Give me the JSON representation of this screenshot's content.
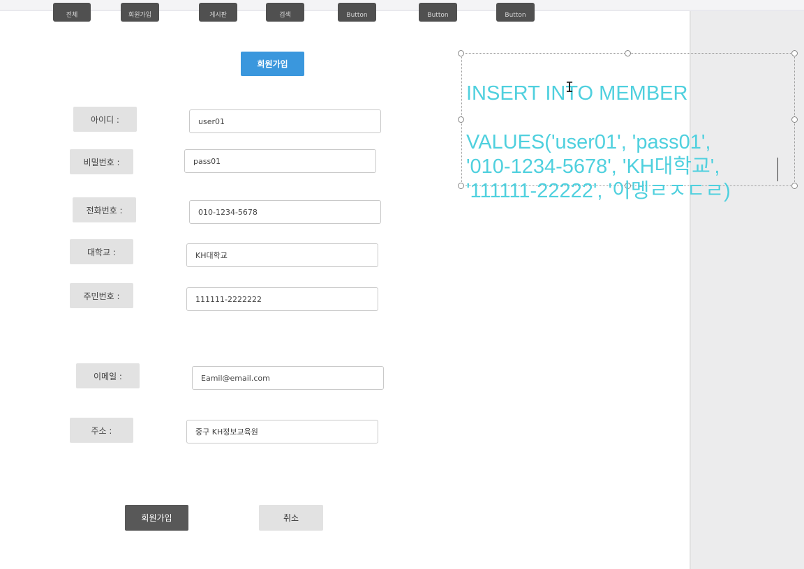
{
  "top_buttons": [
    "전체",
    "회원가입",
    "게시판",
    "검색",
    "Button",
    "Button",
    "Button"
  ],
  "form": {
    "title_button": "회원가입",
    "fields": [
      {
        "label": "아이디 :",
        "value": "user01"
      },
      {
        "label": "비밀번호 :",
        "value": "pass01"
      },
      {
        "label": "전화번호 :",
        "value": "010-1234-5678"
      },
      {
        "label": "대학교 :",
        "value": "KH대학교"
      },
      {
        "label": "주민번호 :",
        "value": "111111-2222222"
      },
      {
        "label": "이메일 :",
        "value": "Eamil@email.com"
      },
      {
        "label": "주소 :",
        "value": "중구 KH정보교육원"
      }
    ],
    "submit_label": "회원가입",
    "cancel_label": "취소"
  },
  "sql_textbox": {
    "lines": [
      "INSERT INTO MEMBER",
      "",
      "VALUES('user01', 'pass01',",
      "'010-1234-5678', 'KH대학교',",
      "'111111-22222', '이멩ㄹㅈㄷㄹ)"
    ],
    "color": "#4fd0de"
  },
  "colors": {
    "accent": "#3a97dd",
    "dark_button": "#585858",
    "label_bg": "#e2e2e2"
  }
}
